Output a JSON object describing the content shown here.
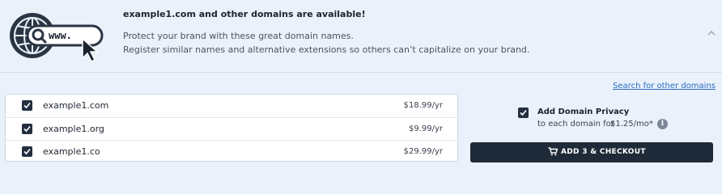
{
  "banner": {
    "title": "example1.com and other domains are available!",
    "line1": "Protect your brand with these great domain names.",
    "line2": "Register similar names and alternative extensions so others can’t capitalize on your brand.",
    "logo_text": "www.",
    "logo_icon": "globe-search-cursor-icon",
    "collapse_icon": "chevron-up-icon"
  },
  "search_link": "Search for other domains",
  "domains": [
    {
      "name": "example1.com",
      "price": "$18.99/yr",
      "checked": true
    },
    {
      "name": "example1.org",
      "price": "$9.99/yr",
      "checked": true
    },
    {
      "name": "example1.co",
      "price": "$29.99/yr",
      "checked": true
    }
  ],
  "privacy": {
    "title": "Add Domain Privacy",
    "sub": "to each domain for",
    "price": "$1.25/mo*",
    "checked": true,
    "info_icon": "info-icon"
  },
  "checkout": {
    "label": "ADD 3 & CHECKOUT",
    "icon": "cart-icon"
  },
  "colors": {
    "background": "#eaf1fa",
    "link": "#2b6cc4",
    "button": "#1f2a38",
    "checkbox": "#243040"
  }
}
